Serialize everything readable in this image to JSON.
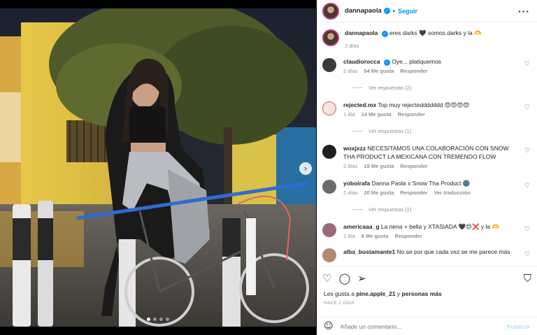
{
  "header": {
    "username": "dannapaola",
    "separator": "•",
    "follow_label": "Seguir",
    "more_label": "···"
  },
  "caption": {
    "username": "dannapaola",
    "text": "eres darks 🖤 somos darks y la 🫶",
    "time": "2 días"
  },
  "comments": [
    {
      "user": "claudiorocca",
      "verified": true,
      "text": "Oye... platiquemos",
      "time": "2 días",
      "likes": "64 Me gusta",
      "reply": "Responder",
      "extra": "",
      "replies": "Ver respuestas (2)",
      "avatar_color": "#3b3b3b"
    },
    {
      "user": "rejected.mx",
      "verified": false,
      "text": "Top muy rejecteddddddd 😍😍😍😍",
      "time": "1 día",
      "likes": "14 Me gusta",
      "reply": "Responder",
      "extra": "",
      "replies": "Ver respuestas (1)",
      "avatar_color": "#e05a4f"
    },
    {
      "user": "woxjxzz",
      "verified": false,
      "text": "NECESITAMOS UNA COLABORACIÓN CON SNOW THA PRODUCT LA MEXICANA CON TREMENDO FLOW",
      "time": "2 días",
      "likes": "15 Me gusta",
      "reply": "Responder",
      "extra": "",
      "replies": "",
      "avatar_color": "#1f1f1f"
    },
    {
      "user": "yoboirafa",
      "verified": false,
      "text": "Danna Paola x Snow Tha Product 🌚",
      "time": "2 días",
      "likes": "20 Me gusta",
      "reply": "Responder",
      "extra": "Ver traducción",
      "replies": "Ver respuestas (1)",
      "avatar_color": "#6b6b6b"
    },
    {
      "user": "americaaa_g",
      "verified": false,
      "text": "La nena + bella y XTASIADA 🖤😍❌ y la 🫶",
      "time": "1 día",
      "likes": "6 Me gusta",
      "reply": "Responder",
      "extra": "",
      "replies": "",
      "avatar_color": "#9a6b7a"
    },
    {
      "user": "alba_bustamante1",
      "verified": false,
      "text": "No se por que cada vez se me parece más",
      "time": "",
      "likes": "",
      "reply": "",
      "extra": "",
      "replies": "",
      "avatar_color": "#b08a70"
    }
  ],
  "footer": {
    "likes_prefix": "Les gusta a",
    "likes_user": "pine.apple_21",
    "likes_suffix": "y",
    "likes_others": "personas más",
    "time": "HACE 2 DÍAS",
    "comment_placeholder": "Añade un comentario...",
    "post_label": "Publicar"
  },
  "media": {
    "next_label": "›",
    "slide_count": 4,
    "active_slide": 1
  },
  "colors": {
    "accent": "#0095f6",
    "post_disabled": "#b2dffc",
    "muted": "#8e8e8e"
  }
}
